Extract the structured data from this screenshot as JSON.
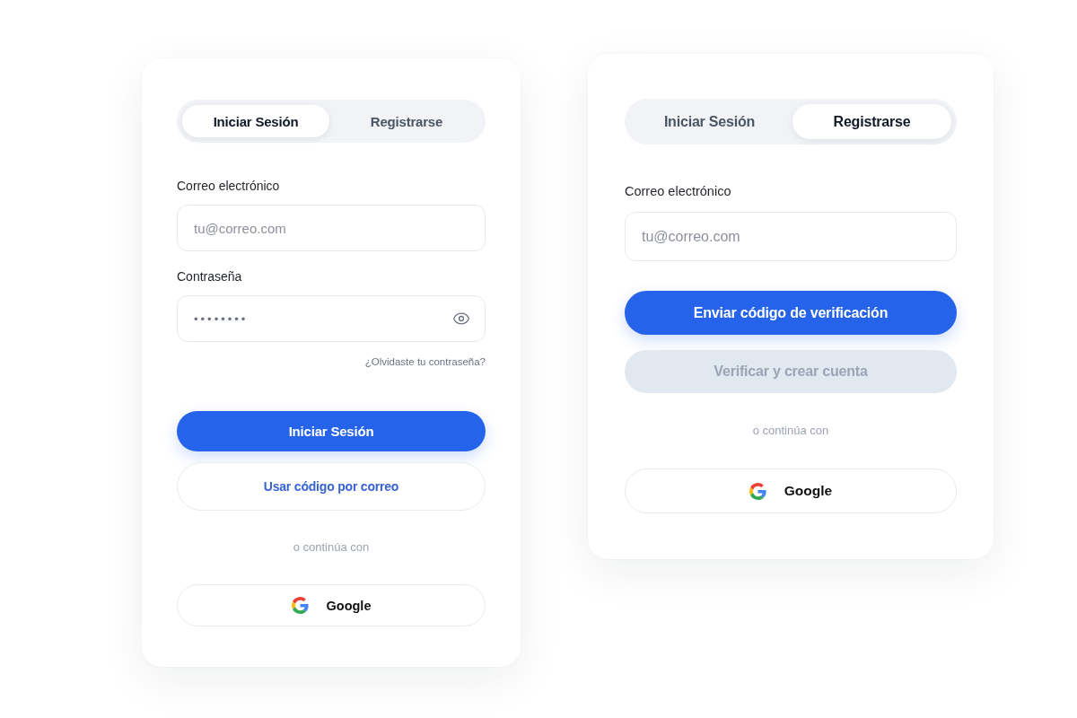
{
  "panels": [
    {
      "tabs": [
        {
          "label": "Iniciar Sesión",
          "selected": true
        },
        {
          "label": "Registrarse",
          "selected": false
        }
      ],
      "fields": [
        {
          "kind": "email",
          "label": "Correo electrónico",
          "placeholder": "tu@correo.com"
        },
        {
          "kind": "password",
          "label": "Contraseña",
          "value": "••••••••"
        }
      ],
      "forgot_link": "¿Olvidaste tu contraseña?",
      "actions": [
        {
          "kind": "primary",
          "label": "Iniciar Sesión",
          "disabled": false
        },
        {
          "kind": "outline",
          "label": "Usar código por correo",
          "disabled": false
        }
      ],
      "divider_text": "o continúa con",
      "social_button": {
        "label": "Google"
      }
    },
    {
      "tabs": [
        {
          "label": "Iniciar Sesión",
          "selected": false
        },
        {
          "label": "Registrarse",
          "selected": true
        }
      ],
      "fields": [
        {
          "kind": "email",
          "label": "Correo electrónico",
          "placeholder": "tu@correo.com"
        }
      ],
      "actions": [
        {
          "kind": "primary",
          "label": "Enviar código de verificación",
          "disabled": false
        },
        {
          "kind": "primary",
          "label": "Verificar y crear cuenta",
          "disabled": true
        }
      ],
      "divider_text": "o continúa con",
      "social_button": {
        "label": "Google"
      }
    }
  ]
}
